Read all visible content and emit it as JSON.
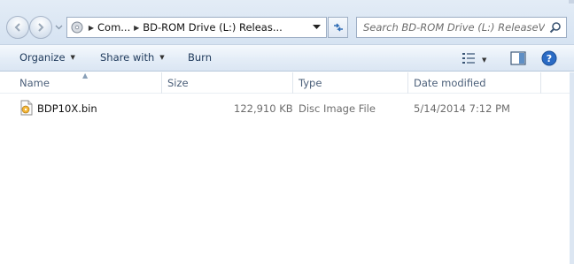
{
  "address_bar": {
    "breadcrumbs": [
      "Com...",
      "BD-ROM Drive (L:) Releas..."
    ],
    "search_placeholder": "Search BD-ROM Drive (L:) ReleaseVer..."
  },
  "command_bar": {
    "organize_label": "Organize",
    "share_label": "Share with",
    "burn_label": "Burn"
  },
  "columns": {
    "name": "Name",
    "size": "Size",
    "type": "Type",
    "date": "Date modified"
  },
  "files": [
    {
      "name": "BDP10X.bin",
      "size": "122,910 KB",
      "type": "Disc Image File",
      "date_modified": "5/14/2014 7:12 PM",
      "icon": "disc-image-file-icon"
    }
  ],
  "icons": {
    "back": "back-arrow-icon",
    "forward": "forward-arrow-icon",
    "drive": "bd-drive-icon",
    "refresh": "refresh-icon",
    "search": "search-icon",
    "view": "change-view-icon",
    "preview": "preview-pane-icon",
    "help": "help-icon"
  },
  "colors": {
    "chrome_top": "#dde7f3",
    "command_text": "#1e395b",
    "header_text": "#4c607a",
    "help_blue": "#2a6bc5"
  }
}
